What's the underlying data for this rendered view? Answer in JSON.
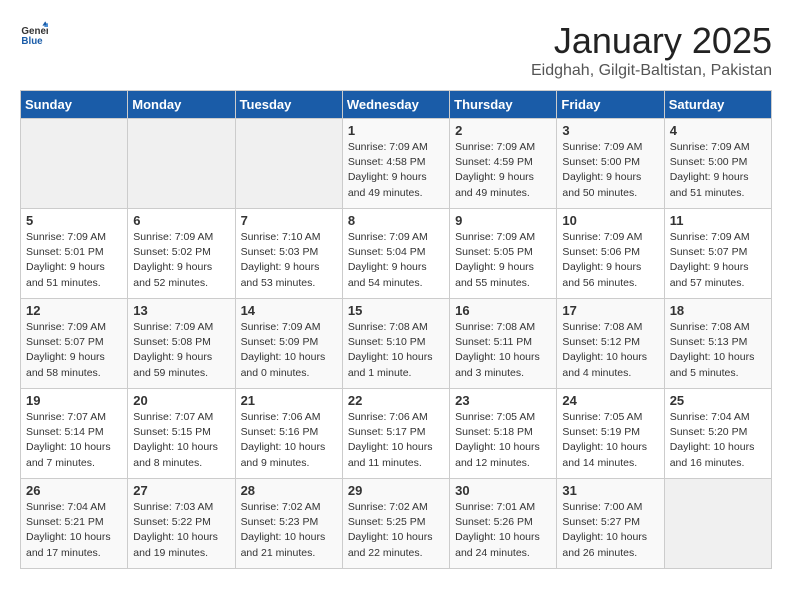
{
  "logo": {
    "general": "General",
    "blue": "Blue"
  },
  "title": "January 2025",
  "subtitle": "Eidghah, Gilgit-Baltistan, Pakistan",
  "days_of_week": [
    "Sunday",
    "Monday",
    "Tuesday",
    "Wednesday",
    "Thursday",
    "Friday",
    "Saturday"
  ],
  "weeks": [
    [
      {
        "day": "",
        "info": ""
      },
      {
        "day": "",
        "info": ""
      },
      {
        "day": "",
        "info": ""
      },
      {
        "day": "1",
        "info": "Sunrise: 7:09 AM\nSunset: 4:58 PM\nDaylight: 9 hours\nand 49 minutes."
      },
      {
        "day": "2",
        "info": "Sunrise: 7:09 AM\nSunset: 4:59 PM\nDaylight: 9 hours\nand 49 minutes."
      },
      {
        "day": "3",
        "info": "Sunrise: 7:09 AM\nSunset: 5:00 PM\nDaylight: 9 hours\nand 50 minutes."
      },
      {
        "day": "4",
        "info": "Sunrise: 7:09 AM\nSunset: 5:00 PM\nDaylight: 9 hours\nand 51 minutes."
      }
    ],
    [
      {
        "day": "5",
        "info": "Sunrise: 7:09 AM\nSunset: 5:01 PM\nDaylight: 9 hours\nand 51 minutes."
      },
      {
        "day": "6",
        "info": "Sunrise: 7:09 AM\nSunset: 5:02 PM\nDaylight: 9 hours\nand 52 minutes."
      },
      {
        "day": "7",
        "info": "Sunrise: 7:10 AM\nSunset: 5:03 PM\nDaylight: 9 hours\nand 53 minutes."
      },
      {
        "day": "8",
        "info": "Sunrise: 7:09 AM\nSunset: 5:04 PM\nDaylight: 9 hours\nand 54 minutes."
      },
      {
        "day": "9",
        "info": "Sunrise: 7:09 AM\nSunset: 5:05 PM\nDaylight: 9 hours\nand 55 minutes."
      },
      {
        "day": "10",
        "info": "Sunrise: 7:09 AM\nSunset: 5:06 PM\nDaylight: 9 hours\nand 56 minutes."
      },
      {
        "day": "11",
        "info": "Sunrise: 7:09 AM\nSunset: 5:07 PM\nDaylight: 9 hours\nand 57 minutes."
      }
    ],
    [
      {
        "day": "12",
        "info": "Sunrise: 7:09 AM\nSunset: 5:07 PM\nDaylight: 9 hours\nand 58 minutes."
      },
      {
        "day": "13",
        "info": "Sunrise: 7:09 AM\nSunset: 5:08 PM\nDaylight: 9 hours\nand 59 minutes."
      },
      {
        "day": "14",
        "info": "Sunrise: 7:09 AM\nSunset: 5:09 PM\nDaylight: 10 hours\nand 0 minutes."
      },
      {
        "day": "15",
        "info": "Sunrise: 7:08 AM\nSunset: 5:10 PM\nDaylight: 10 hours\nand 1 minute."
      },
      {
        "day": "16",
        "info": "Sunrise: 7:08 AM\nSunset: 5:11 PM\nDaylight: 10 hours\nand 3 minutes."
      },
      {
        "day": "17",
        "info": "Sunrise: 7:08 AM\nSunset: 5:12 PM\nDaylight: 10 hours\nand 4 minutes."
      },
      {
        "day": "18",
        "info": "Sunrise: 7:08 AM\nSunset: 5:13 PM\nDaylight: 10 hours\nand 5 minutes."
      }
    ],
    [
      {
        "day": "19",
        "info": "Sunrise: 7:07 AM\nSunset: 5:14 PM\nDaylight: 10 hours\nand 7 minutes."
      },
      {
        "day": "20",
        "info": "Sunrise: 7:07 AM\nSunset: 5:15 PM\nDaylight: 10 hours\nand 8 minutes."
      },
      {
        "day": "21",
        "info": "Sunrise: 7:06 AM\nSunset: 5:16 PM\nDaylight: 10 hours\nand 9 minutes."
      },
      {
        "day": "22",
        "info": "Sunrise: 7:06 AM\nSunset: 5:17 PM\nDaylight: 10 hours\nand 11 minutes."
      },
      {
        "day": "23",
        "info": "Sunrise: 7:05 AM\nSunset: 5:18 PM\nDaylight: 10 hours\nand 12 minutes."
      },
      {
        "day": "24",
        "info": "Sunrise: 7:05 AM\nSunset: 5:19 PM\nDaylight: 10 hours\nand 14 minutes."
      },
      {
        "day": "25",
        "info": "Sunrise: 7:04 AM\nSunset: 5:20 PM\nDaylight: 10 hours\nand 16 minutes."
      }
    ],
    [
      {
        "day": "26",
        "info": "Sunrise: 7:04 AM\nSunset: 5:21 PM\nDaylight: 10 hours\nand 17 minutes."
      },
      {
        "day": "27",
        "info": "Sunrise: 7:03 AM\nSunset: 5:22 PM\nDaylight: 10 hours\nand 19 minutes."
      },
      {
        "day": "28",
        "info": "Sunrise: 7:02 AM\nSunset: 5:23 PM\nDaylight: 10 hours\nand 21 minutes."
      },
      {
        "day": "29",
        "info": "Sunrise: 7:02 AM\nSunset: 5:25 PM\nDaylight: 10 hours\nand 22 minutes."
      },
      {
        "day": "30",
        "info": "Sunrise: 7:01 AM\nSunset: 5:26 PM\nDaylight: 10 hours\nand 24 minutes."
      },
      {
        "day": "31",
        "info": "Sunrise: 7:00 AM\nSunset: 5:27 PM\nDaylight: 10 hours\nand 26 minutes."
      },
      {
        "day": "",
        "info": ""
      }
    ]
  ]
}
